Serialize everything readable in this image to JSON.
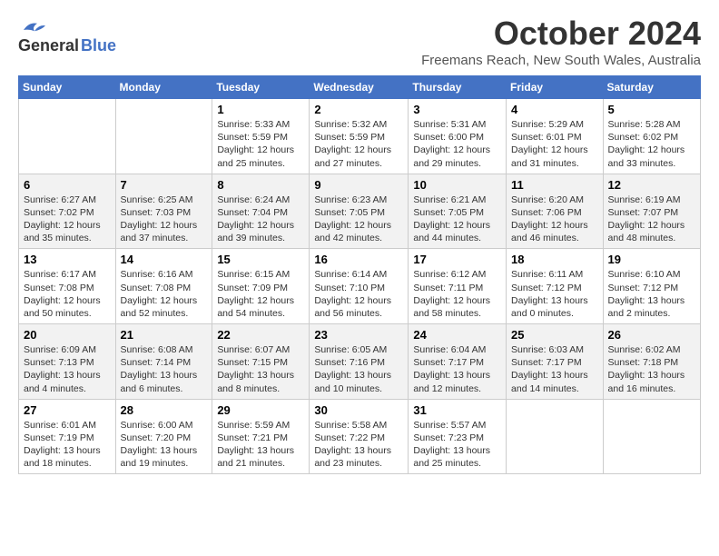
{
  "header": {
    "logo_line1": "General",
    "logo_line2": "Blue",
    "month": "October 2024",
    "location": "Freemans Reach, New South Wales, Australia"
  },
  "days_of_week": [
    "Sunday",
    "Monday",
    "Tuesday",
    "Wednesday",
    "Thursday",
    "Friday",
    "Saturday"
  ],
  "weeks": [
    [
      {
        "day": "",
        "info": ""
      },
      {
        "day": "",
        "info": ""
      },
      {
        "day": "1",
        "info": "Sunrise: 5:33 AM\nSunset: 5:59 PM\nDaylight: 12 hours\nand 25 minutes."
      },
      {
        "day": "2",
        "info": "Sunrise: 5:32 AM\nSunset: 5:59 PM\nDaylight: 12 hours\nand 27 minutes."
      },
      {
        "day": "3",
        "info": "Sunrise: 5:31 AM\nSunset: 6:00 PM\nDaylight: 12 hours\nand 29 minutes."
      },
      {
        "day": "4",
        "info": "Sunrise: 5:29 AM\nSunset: 6:01 PM\nDaylight: 12 hours\nand 31 minutes."
      },
      {
        "day": "5",
        "info": "Sunrise: 5:28 AM\nSunset: 6:02 PM\nDaylight: 12 hours\nand 33 minutes."
      }
    ],
    [
      {
        "day": "6",
        "info": "Sunrise: 6:27 AM\nSunset: 7:02 PM\nDaylight: 12 hours\nand 35 minutes."
      },
      {
        "day": "7",
        "info": "Sunrise: 6:25 AM\nSunset: 7:03 PM\nDaylight: 12 hours\nand 37 minutes."
      },
      {
        "day": "8",
        "info": "Sunrise: 6:24 AM\nSunset: 7:04 PM\nDaylight: 12 hours\nand 39 minutes."
      },
      {
        "day": "9",
        "info": "Sunrise: 6:23 AM\nSunset: 7:05 PM\nDaylight: 12 hours\nand 42 minutes."
      },
      {
        "day": "10",
        "info": "Sunrise: 6:21 AM\nSunset: 7:05 PM\nDaylight: 12 hours\nand 44 minutes."
      },
      {
        "day": "11",
        "info": "Sunrise: 6:20 AM\nSunset: 7:06 PM\nDaylight: 12 hours\nand 46 minutes."
      },
      {
        "day": "12",
        "info": "Sunrise: 6:19 AM\nSunset: 7:07 PM\nDaylight: 12 hours\nand 48 minutes."
      }
    ],
    [
      {
        "day": "13",
        "info": "Sunrise: 6:17 AM\nSunset: 7:08 PM\nDaylight: 12 hours\nand 50 minutes."
      },
      {
        "day": "14",
        "info": "Sunrise: 6:16 AM\nSunset: 7:08 PM\nDaylight: 12 hours\nand 52 minutes."
      },
      {
        "day": "15",
        "info": "Sunrise: 6:15 AM\nSunset: 7:09 PM\nDaylight: 12 hours\nand 54 minutes."
      },
      {
        "day": "16",
        "info": "Sunrise: 6:14 AM\nSunset: 7:10 PM\nDaylight: 12 hours\nand 56 minutes."
      },
      {
        "day": "17",
        "info": "Sunrise: 6:12 AM\nSunset: 7:11 PM\nDaylight: 12 hours\nand 58 minutes."
      },
      {
        "day": "18",
        "info": "Sunrise: 6:11 AM\nSunset: 7:12 PM\nDaylight: 13 hours\nand 0 minutes."
      },
      {
        "day": "19",
        "info": "Sunrise: 6:10 AM\nSunset: 7:12 PM\nDaylight: 13 hours\nand 2 minutes."
      }
    ],
    [
      {
        "day": "20",
        "info": "Sunrise: 6:09 AM\nSunset: 7:13 PM\nDaylight: 13 hours\nand 4 minutes."
      },
      {
        "day": "21",
        "info": "Sunrise: 6:08 AM\nSunset: 7:14 PM\nDaylight: 13 hours\nand 6 minutes."
      },
      {
        "day": "22",
        "info": "Sunrise: 6:07 AM\nSunset: 7:15 PM\nDaylight: 13 hours\nand 8 minutes."
      },
      {
        "day": "23",
        "info": "Sunrise: 6:05 AM\nSunset: 7:16 PM\nDaylight: 13 hours\nand 10 minutes."
      },
      {
        "day": "24",
        "info": "Sunrise: 6:04 AM\nSunset: 7:17 PM\nDaylight: 13 hours\nand 12 minutes."
      },
      {
        "day": "25",
        "info": "Sunrise: 6:03 AM\nSunset: 7:17 PM\nDaylight: 13 hours\nand 14 minutes."
      },
      {
        "day": "26",
        "info": "Sunrise: 6:02 AM\nSunset: 7:18 PM\nDaylight: 13 hours\nand 16 minutes."
      }
    ],
    [
      {
        "day": "27",
        "info": "Sunrise: 6:01 AM\nSunset: 7:19 PM\nDaylight: 13 hours\nand 18 minutes."
      },
      {
        "day": "28",
        "info": "Sunrise: 6:00 AM\nSunset: 7:20 PM\nDaylight: 13 hours\nand 19 minutes."
      },
      {
        "day": "29",
        "info": "Sunrise: 5:59 AM\nSunset: 7:21 PM\nDaylight: 13 hours\nand 21 minutes."
      },
      {
        "day": "30",
        "info": "Sunrise: 5:58 AM\nSunset: 7:22 PM\nDaylight: 13 hours\nand 23 minutes."
      },
      {
        "day": "31",
        "info": "Sunrise: 5:57 AM\nSunset: 7:23 PM\nDaylight: 13 hours\nand 25 minutes."
      },
      {
        "day": "",
        "info": ""
      },
      {
        "day": "",
        "info": ""
      }
    ]
  ]
}
